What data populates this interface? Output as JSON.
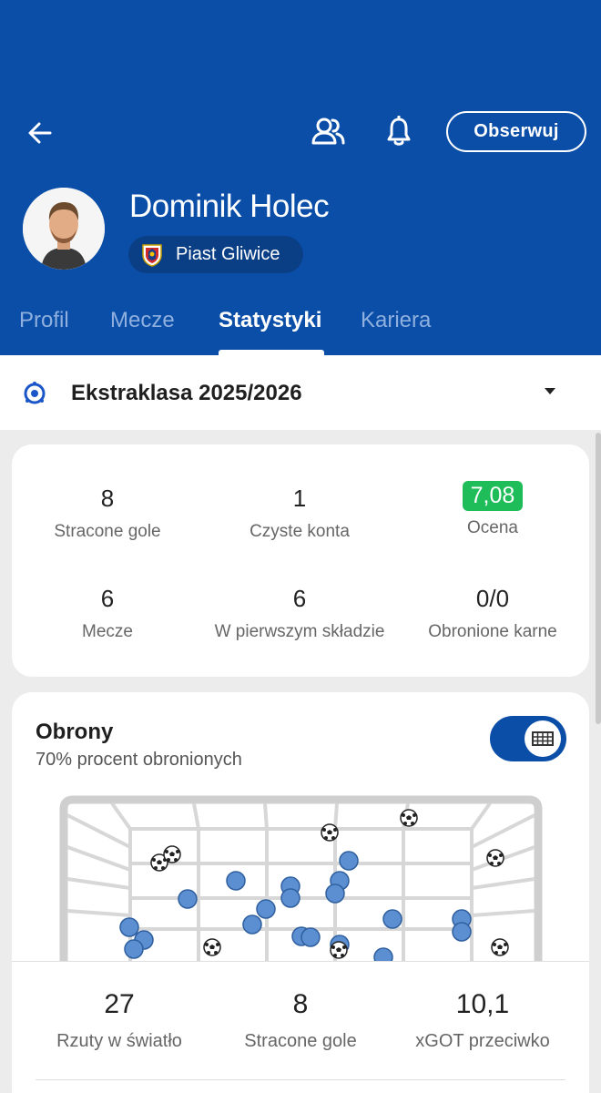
{
  "header": {
    "player_name": "Dominik Holec",
    "club": "Piast Gliwice",
    "follow_label": "Obserwuj",
    "icons": [
      "arrow-left-icon",
      "users-icon",
      "bell-icon"
    ],
    "background_color": "#0b4ea8"
  },
  "tabs": [
    {
      "label": "Profil",
      "active": false
    },
    {
      "label": "Mecze",
      "active": false
    },
    {
      "label": "Statystyki",
      "active": true
    },
    {
      "label": "Kariera",
      "active": false
    }
  ],
  "competition": {
    "name": "Ekstraklasa 2025/2026"
  },
  "stats": [
    {
      "value": "8",
      "label": "Stracone gole"
    },
    {
      "value": "1",
      "label": "Czyste konta"
    },
    {
      "value": "7,08",
      "label": "Ocena",
      "highlight_color": "#1fbd5a"
    },
    {
      "value": "6",
      "label": "Mecze"
    },
    {
      "value": "6",
      "label": "W pierwszym składzie"
    },
    {
      "value": "0/0",
      "label": "Obronione karne"
    }
  ],
  "saves": {
    "title": "Obrony",
    "subtitle": "70% procent obronionych",
    "toggle_icon": "goal-net-icon",
    "bottom_stats": [
      {
        "value": "27",
        "label": "Rzuty w światło"
      },
      {
        "value": "8",
        "label": "Stracone gole"
      },
      {
        "value": "10,1",
        "label": "xGOT przeciwko"
      }
    ],
    "save_color": "#5b8fd1",
    "goal_icon": "football-icon"
  }
}
